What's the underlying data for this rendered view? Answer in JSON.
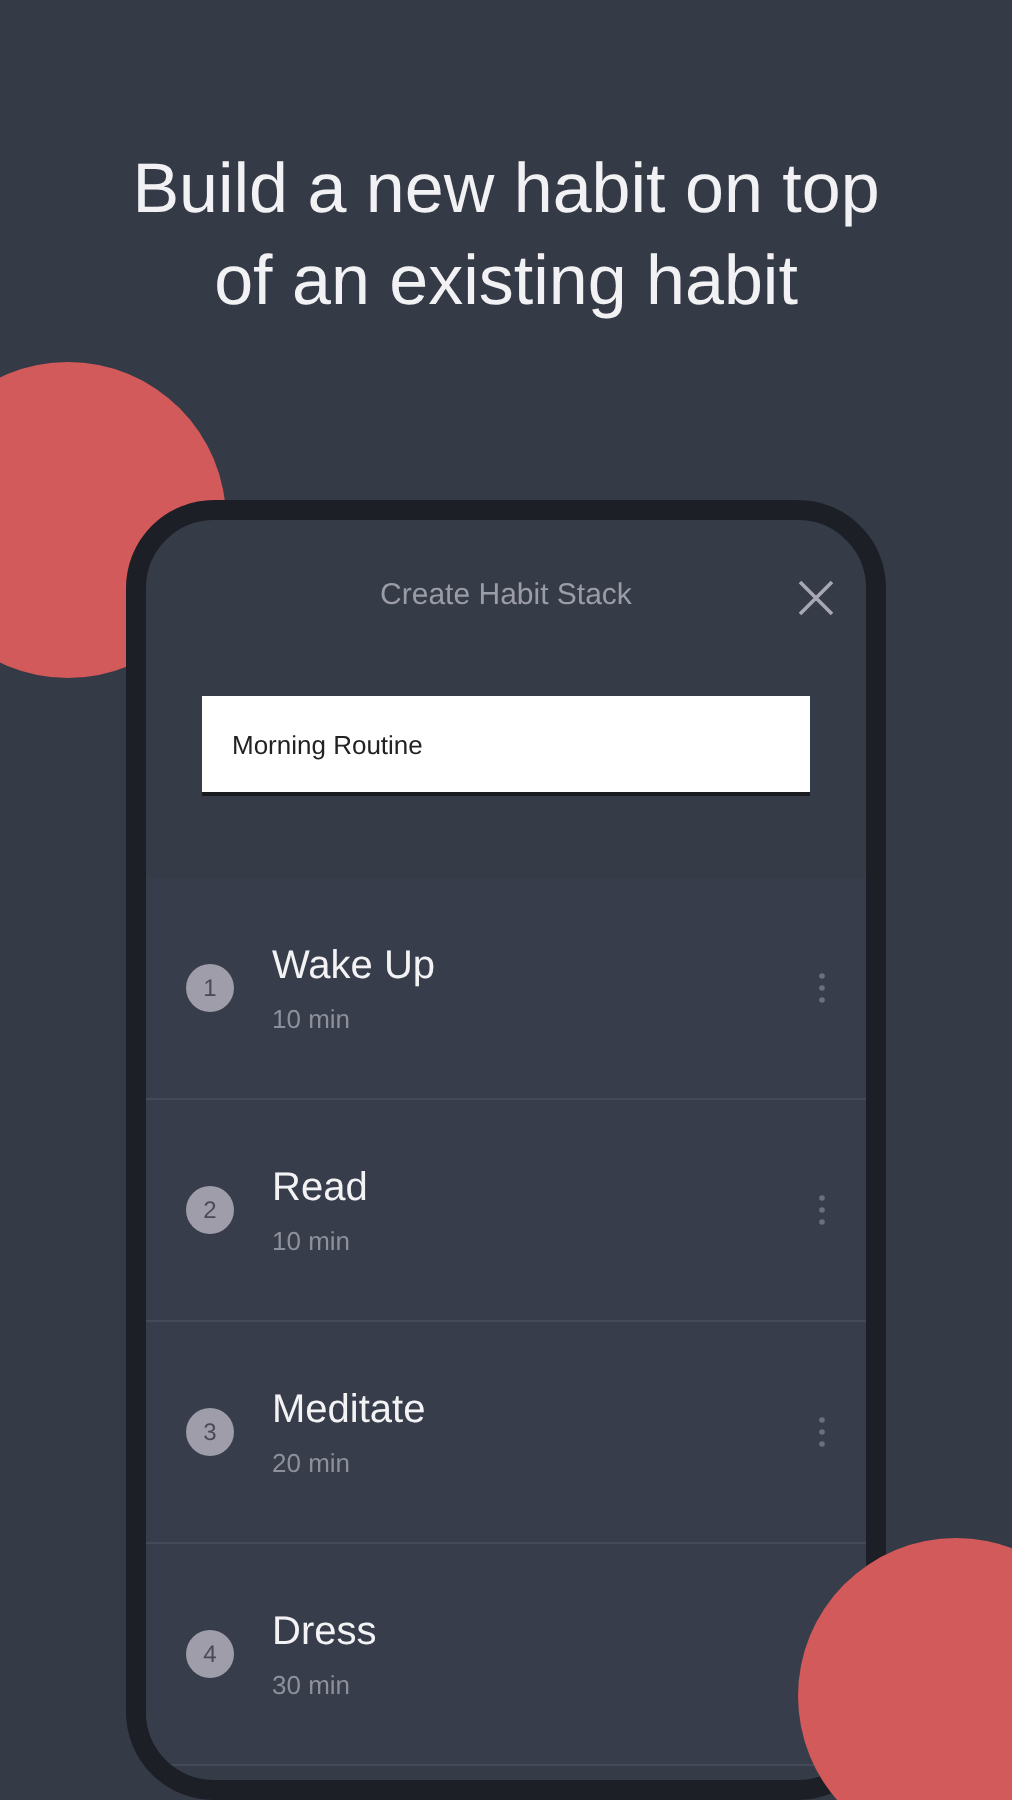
{
  "headline": "Build a new habit on top of an existing habit",
  "dialog": {
    "title": "Create Habit Stack",
    "name_field": {
      "value": "Morning Routine"
    }
  },
  "habits": [
    {
      "number": "1",
      "name": "Wake Up",
      "duration": "10 min",
      "menu_visible": true
    },
    {
      "number": "2",
      "name": "Read",
      "duration": "10 min",
      "menu_visible": true
    },
    {
      "number": "3",
      "name": "Meditate",
      "duration": "20 min",
      "menu_visible": true
    },
    {
      "number": "4",
      "name": "Dress",
      "duration": "30 min",
      "menu_visible": false
    }
  ]
}
